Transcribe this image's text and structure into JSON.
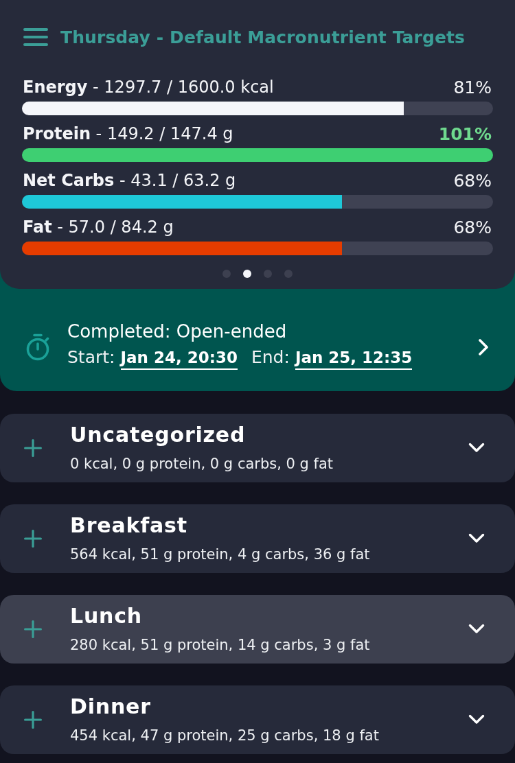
{
  "header": {
    "title": "Thursday - Default Macronutrient Targets"
  },
  "macros": [
    {
      "label": "**Energy** - 1297.7 / 1600.0 kcal",
      "percent": "81%",
      "level": 0.81,
      "color": "#f5f6fa",
      "target_met": false
    },
    {
      "label": "**Protein** - 149.2 / 147.4 g",
      "percent": "101%",
      "level": 1,
      "color": "#3ecf72",
      "target_met": true
    },
    {
      "label": "**Net Carbs** - 43.1 / 63.2 g",
      "percent": "68%",
      "level": 0.68,
      "color": "#1ec8d8",
      "target_met": false
    },
    {
      "label": "**Fat** - 57.0 / 84.2 g",
      "percent": "68%",
      "level": 0.68,
      "color": "#e63c00",
      "target_met": false
    }
  ],
  "pages": [
    {
      "selected": false
    },
    {
      "selected": true
    },
    {
      "selected": false
    },
    {
      "selected": false
    }
  ],
  "fast": {
    "status": "Completed: Open-ended",
    "start_label": "Start:",
    "start": "Jan 24, 20:30",
    "end_label": "End:",
    "end": "Jan 25, 12:35"
  },
  "meals": [
    {
      "name": "Uncategorized",
      "summary": "0 kcal, 0 g protein, 0 g carbs, 0 g fat",
      "selected": false
    },
    {
      "name": "Breakfast",
      "summary": "564 kcal, 51 g protein, 4 g carbs, 36 g fat",
      "selected": false
    },
    {
      "name": "Lunch",
      "summary": "280 kcal, 51 g protein, 14 g carbs, 3 g fat",
      "selected": true
    },
    {
      "name": "Dinner",
      "summary": "454 kcal, 47 g protein, 25 g carbs, 18 g fat",
      "selected": false
    }
  ]
}
